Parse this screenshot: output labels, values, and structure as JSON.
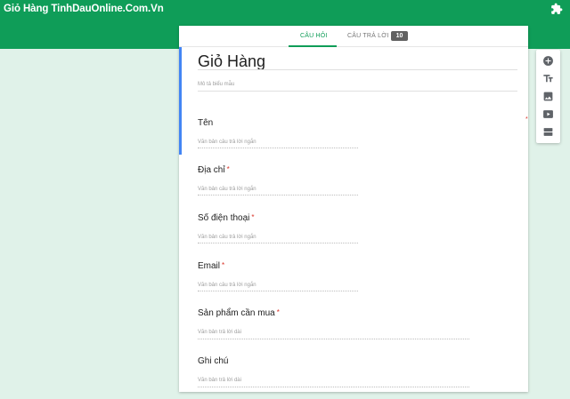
{
  "app": {
    "title": "Giỏ Hàng TinhDauOnline.Com.Vn",
    "addon_icon": "puzzle-icon"
  },
  "tabs": {
    "questions": "CÂU HỎI",
    "responses": "CÂU TRẢ LỜI",
    "responses_count": "10"
  },
  "form": {
    "title": "Giỏ Hàng",
    "description_placeholder": "Mô tả biểu mẫu"
  },
  "questions": [
    {
      "label": "Tên",
      "hint": "Văn bản câu trả lời ngắn",
      "required": false
    },
    {
      "label": "Địa chỉ",
      "hint": "Văn bản câu trả lời ngắn",
      "required": true
    },
    {
      "label": "Số điện thoại",
      "hint": "Văn bản câu trả lời ngắn",
      "required": true
    },
    {
      "label": "Email",
      "hint": "Văn bản câu trả lời ngắn",
      "required": true
    },
    {
      "label": "Sản phẩm cần mua",
      "hint": "Văn bản trả lời dài",
      "required": true
    },
    {
      "label": "Ghi chú",
      "hint": "Văn bản trả lời dài",
      "required": false
    }
  ],
  "required_mark": "*",
  "toolbar": {
    "items": [
      "add-question-icon",
      "add-title-icon",
      "add-image-icon",
      "add-video-icon",
      "add-section-icon"
    ]
  },
  "colors": {
    "brand": "#0f9d58",
    "background": "#e0f2e9",
    "active_bar": "#4285f4",
    "required": "#d93025"
  }
}
